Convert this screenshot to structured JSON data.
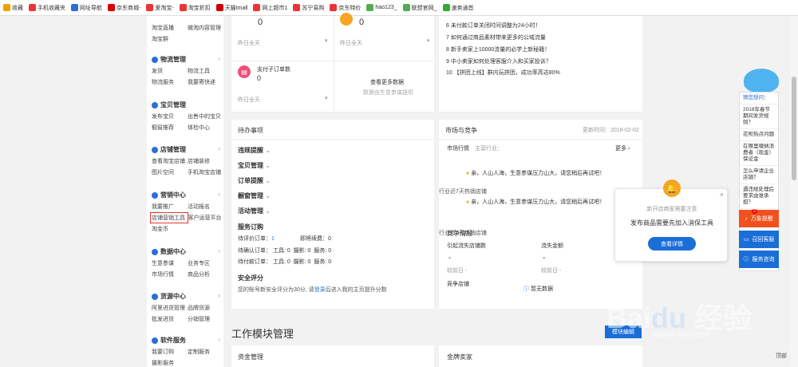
{
  "bookmarks": [
    "收藏",
    "手机收藏夹",
    "网址导航",
    "京东商城-",
    "爱淘宝-",
    "淘宝折扣",
    "天猫tmall",
    "网上超市1",
    "苏宁易购",
    "京东特价",
    "hao123_",
    "联想官网_",
    "速卖通首"
  ],
  "sidebar": {
    "top": [
      "淘宝直播",
      "微淘内容管理",
      "淘宝群"
    ],
    "logistics": {
      "title": "物流管理",
      "items": [
        "发货",
        "物流工具",
        "物流服务",
        "我要寄快递"
      ]
    },
    "products": {
      "title": "宝贝管理",
      "items": [
        "发布宝贝",
        "出售中的宝贝",
        "橱窗推荐",
        "体检中心"
      ]
    },
    "shop": {
      "title": "店铺管理",
      "items": [
        "查看淘宝店铺",
        "店铺装修",
        "图片空间",
        "手机淘宝店铺"
      ]
    },
    "marketing": {
      "title": "营销中心",
      "items": [
        "我要推广",
        "活动报名",
        "店铺营销工具",
        "客户运营平台",
        "淘金币"
      ]
    },
    "data": {
      "title": "数据中心",
      "items": [
        "生意参谋",
        "业务专区",
        "市场行情",
        "商品分析"
      ]
    },
    "supply": {
      "title": "货源中心",
      "items": [
        "阿里进货管理",
        "品牌货源",
        "批发进货",
        "分销管理"
      ]
    },
    "software": {
      "title": "软件服务",
      "items": [
        "我要订购",
        "定制服务",
        "摄影服务"
      ]
    }
  },
  "stats": {
    "v1": "0",
    "v2": "0",
    "yest": "昨日全天",
    "pay_label": "支付子订单数",
    "pay_value": "0",
    "more": "查看更多数据",
    "more_sub": "数据由生意参谋提供"
  },
  "news": [
    "6  未付款订单关闭时间调整为24小时！",
    "7  如何通过商品素材带来更多的公域流量",
    "8  新手卖家上10000流量的必学上新秘籍！",
    "9  中小卖家如何处理客服介入和买家投诉？",
    "10  【拼团上线】群内玩拼团，成功率高达80%"
  ],
  "todo": {
    "title": "待办事项",
    "menus": [
      "违规提醒",
      "宝贝管理",
      "订单提醒",
      "橱窗管理",
      "活动管理"
    ],
    "svc_title": "服务订购",
    "svc_rows": [
      [
        "待评价订单：",
        "1",
        "",
        "即将续费：0"
      ],
      [
        "待确认订单：",
        "工具: 0",
        "摄影: 0",
        "服务: 0"
      ],
      [
        "待付款订单：",
        "工具: 0",
        "摄影: 0",
        "服务: 0"
      ]
    ],
    "safe_title": "安全评分",
    "safe_text": "您的账号新安全评分为30分, 请",
    "safe_link": "登录",
    "safe_text2": "后进入我的主页提升分数"
  },
  "market": {
    "title": "市场与竞争",
    "update": "更新时间：2018-02-02",
    "tab": "市场行情",
    "main_cat": "主营行业：",
    "more": "更多",
    "tip": "亲，人山人海，生意参谋压力山大，请您稍后再试吧！",
    "hot": "行业近7天热销店铺",
    "comp_title": "竞争情报",
    "lose_store": "引起流失店铺数",
    "lose_amt": "流失金额",
    "dash": "-",
    "prev": "较前日 -",
    "comp_store": "竞争店铺",
    "nodata": "暂无数据"
  },
  "popup": {
    "title": "新开店商家需要注意",
    "text": "发布商品需要先加入消保工具",
    "btn": "查看详情"
  },
  "right_panel": {
    "head": "猜您想问：",
    "qs": [
      "2018年春节期间发货规则？",
      "花呗热点问题",
      "在哪里缴纳消费者（现金）保证金",
      "怎么申请企业店铺？",
      "遇违规处理后要求由谁承担？"
    ],
    "b1": "万象提醒",
    "b2": "召回客服",
    "b3": "服务咨询",
    "badge": "2"
  },
  "work": {
    "title": "工作模块管理",
    "btn": "模块编辑",
    "funds": "资金管理",
    "gold": "金牌卖家",
    "top": "顶部"
  },
  "watermark": "jingyan.baidu.com",
  "colors": {
    "blue": "#2b6fd6",
    "orange": "#f08a00",
    "red": "#e8453c"
  }
}
